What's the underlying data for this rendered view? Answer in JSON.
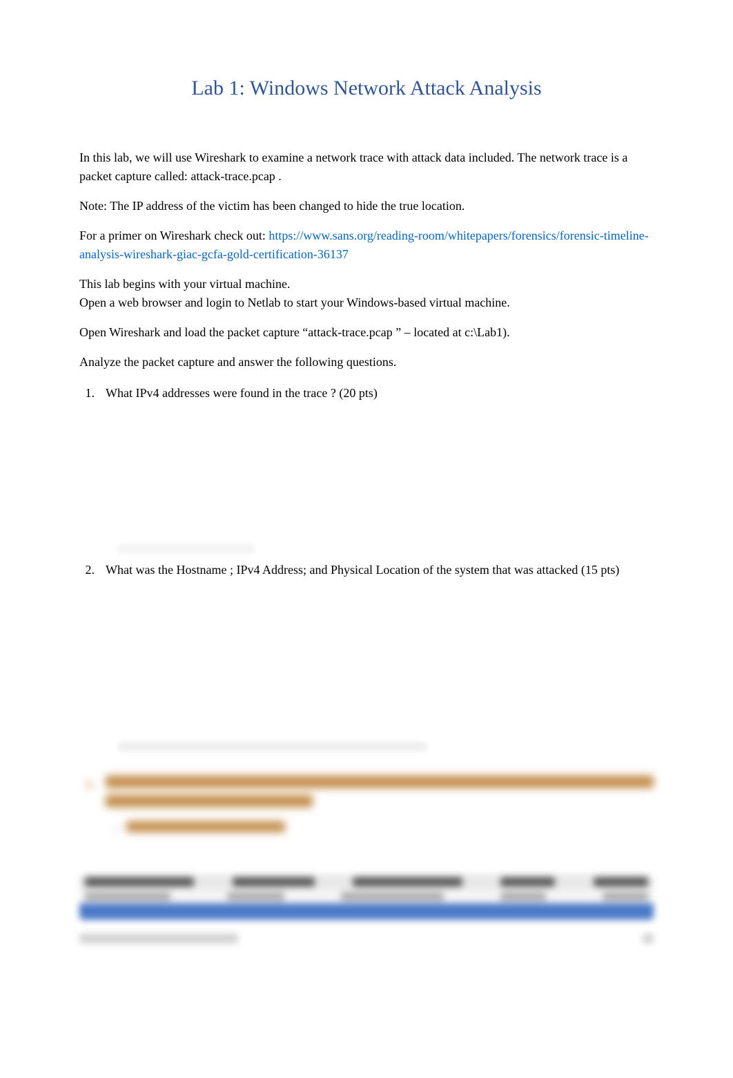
{
  "title": "Lab 1: Windows Network Attack Analysis",
  "intro": "In this lab, we will use Wireshark to examine a network trace with attack data included.    The network trace is a packet capture called:  attack-trace.pcap .",
  "note": "Note: The IP address of the victim has been changed to hide the true location.",
  "primer_prefix": "For a primer on Wireshark check out: ",
  "primer_link": "https://www.sans.org/reading-room/whitepapers/forensics/forensic-timeline-analysis-wireshark-giac-gcfa-gold-certification-36137",
  "begin_line1": "This lab begins with your virtual machine.",
  "begin_line2": "Open a web browser and login to Netlab to start your Windows-based virtual machine.",
  "open_wireshark": "Open Wireshark and load the packet capture “attack-trace.pcap     ” – located at c:\\Lab1).",
  "analyze": "Analyze the packet capture and answer the following questions.",
  "questions": {
    "q1": {
      "num": "1.",
      "text": "What IPv4 addresses were found in the trace   ? (20 pts)"
    },
    "q2": {
      "num": "2.",
      "text_pre": "What was the  Hostname ; IPv4 Address; and  Physical Location of the system that was attacked (15 pts)"
    }
  }
}
